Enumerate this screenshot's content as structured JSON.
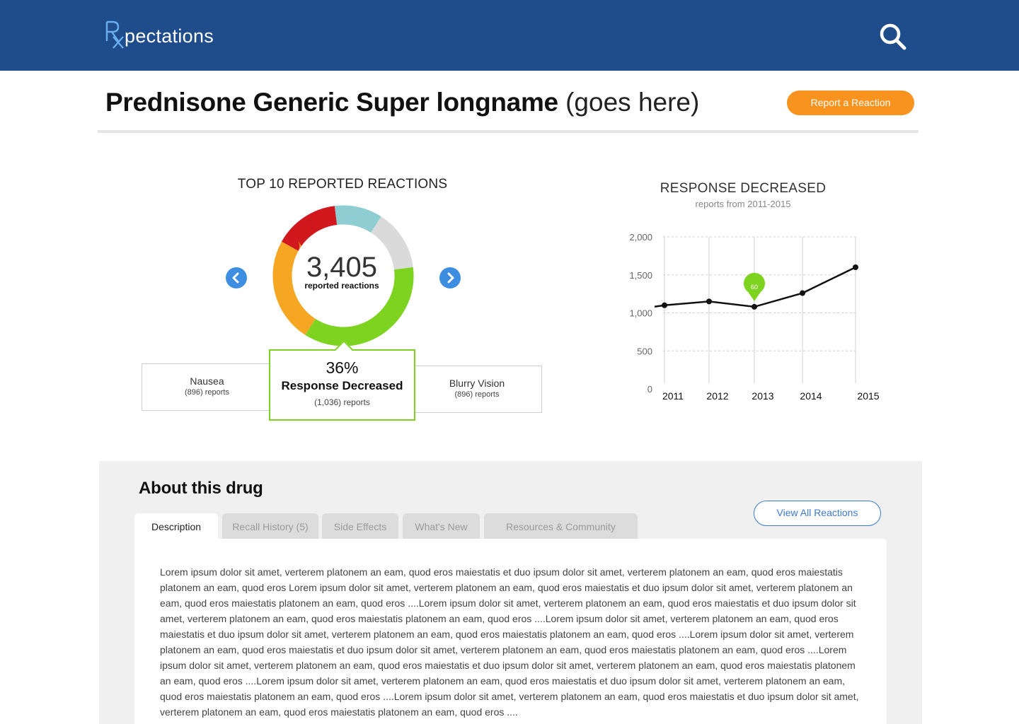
{
  "header": {
    "logo_rx": "Rx",
    "logo_text": "pectations",
    "search_icon": "search-icon"
  },
  "drug": {
    "name": "Prednisone Generic Super longname",
    "name_suffix": "(goes here)",
    "report_button": "Report a Reaction"
  },
  "donut": {
    "title": "TOP 10 REPORTED REACTIONS",
    "total": "3,405",
    "total_label": "reported reactions",
    "segments": [
      {
        "color": "#d0181d",
        "share": 0.15
      },
      {
        "color": "#8ecdd2",
        "share": 0.11
      },
      {
        "color": "#dadada",
        "share": 0.14
      },
      {
        "color": "#7ed321",
        "share": 0.36
      },
      {
        "color": "#f5a623",
        "share": 0.24
      }
    ],
    "prev_icon": "chevron-left-icon",
    "next_icon": "chevron-right-icon",
    "cards": {
      "left": {
        "name": "Nausea",
        "count": "(896) reports"
      },
      "center": {
        "pct": "36%",
        "name": "Response Decreased",
        "count": "(1,036) reports"
      },
      "right": {
        "name": "Blurry Vision",
        "count": "(896) reports"
      }
    }
  },
  "chart_data": {
    "type": "line",
    "title": "RESPONSE DECREASED",
    "subtitle": "reports from 2011-2015",
    "x": [
      "2011",
      "2012",
      "2013",
      "2014",
      "2015"
    ],
    "series": [
      {
        "values": [
          1100,
          1150,
          1080,
          1260,
          1600
        ]
      }
    ],
    "y_ticks": [
      "0",
      "500",
      "1,000",
      "1,500",
      "2,000"
    ],
    "ylim": [
      0,
      2000
    ],
    "grid": true,
    "marker_label": "60",
    "marker_x": "2013"
  },
  "about": {
    "title": "About this drug",
    "view_all": "View All Reactions",
    "tabs": [
      "Description",
      "Recall History (5)",
      "Side Effects",
      "What's New",
      "Resources & Community"
    ],
    "description": "Lorem ipsum dolor sit amet, verterem platonem an eam, quod eros maiestatis et duo ipsum dolor sit amet, verterem platonem an eam, quod eros maiestatis platonem an eam, quod eros Lorem ipsum dolor sit amet, verterem platonem an eam, quod eros maiestatis et duo ipsum dolor sit amet, verterem platonem an eam, quod eros maiestatis platonem an eam, quod eros ....Lorem ipsum dolor sit amet, verterem platonem an eam, quod eros maiestatis et duo ipsum dolor sit amet, verterem platonem an eam, quod eros maiestatis platonem an eam, quod eros ....Lorem ipsum dolor sit amet, verterem platonem an eam, quod eros maiestatis et duo ipsum dolor sit amet, verterem platonem an eam, quod eros maiestatis platonem an eam, quod eros ....Lorem ipsum dolor sit amet, verterem platonem an eam, quod eros maiestatis et duo ipsum dolor sit amet, verterem platonem an eam, quod eros maiestatis platonem an eam, quod eros ....Lorem ipsum dolor sit amet, verterem platonem an eam, quod eros maiestatis et duo ipsum dolor sit amet, verterem platonem an eam, quod eros maiestatis platonem an eam, quod eros ....Lorem ipsum dolor sit amet, verterem platonem an eam, quod eros maiestatis et duo ipsum dolor sit amet, verterem platonem an eam, quod eros maiestatis platonem an eam, quod eros ....Lorem ipsum dolor sit amet, verterem platonem an eam, quod eros maiestatis et duo ipsum dolor sit amet, verterem platonem an eam, quod eros maiestatis platonem an eam, quod eros ...."
  },
  "colors": {
    "brand_blue": "#1f4d8c",
    "accent_orange": "#f7931e",
    "highlight_green": "#7ed321",
    "link_blue": "#3d7ad0"
  }
}
